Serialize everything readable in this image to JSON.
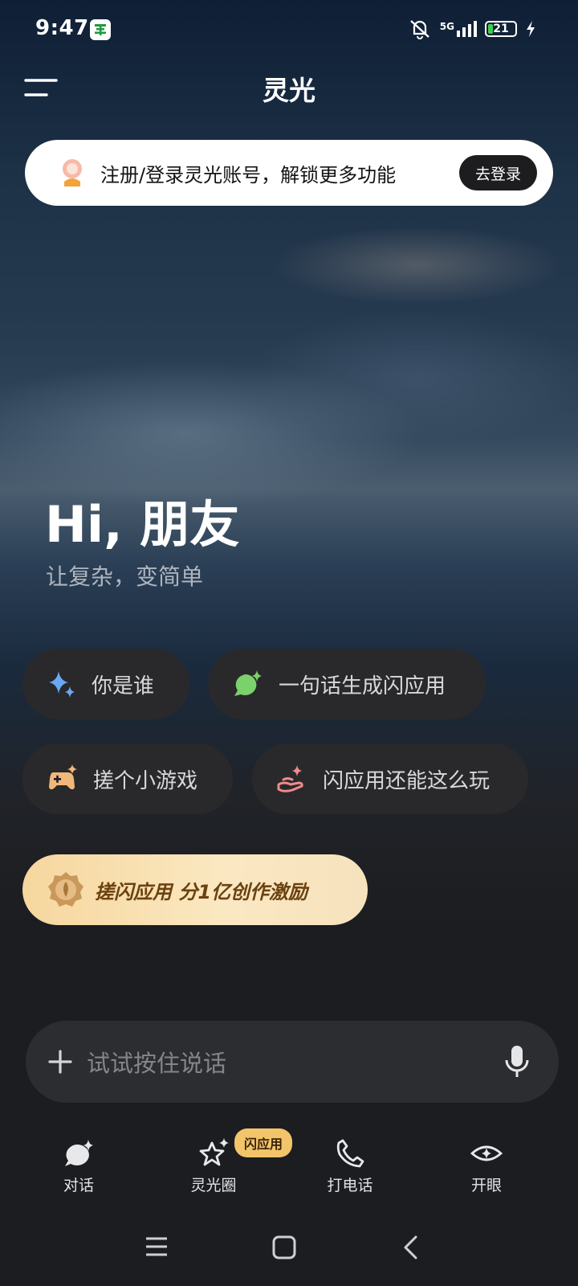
{
  "status_bar": {
    "time": "9:47",
    "network": "5G",
    "battery": "21"
  },
  "header": {
    "title": "灵光"
  },
  "login_banner": {
    "text": "注册/登录灵光账号，解锁更多功能",
    "button": "去登录"
  },
  "greeting": {
    "title": "Hi, 朋友",
    "subtitle": "让复杂，变简单"
  },
  "suggestions": [
    {
      "label": "你是谁",
      "icon": "sparkle-icon"
    },
    {
      "label": "一句话生成闪应用",
      "icon": "chat-bubble-sparkle-icon"
    },
    {
      "label": "搓个小游戏",
      "icon": "gamepad-icon"
    },
    {
      "label": "闪应用还能这么玩",
      "icon": "hand-sparkle-icon"
    }
  ],
  "promo": {
    "text": "搓闪应用 分1亿创作激励",
    "icon": "medal-icon"
  },
  "input": {
    "placeholder": "试试按住说话"
  },
  "tabs": [
    {
      "label": "对话",
      "icon": "chat-bubble-sparkle-icon",
      "active": true
    },
    {
      "label": "灵光圈",
      "icon": "star-sparkle-icon",
      "badge": "闪应用"
    },
    {
      "label": "打电话",
      "icon": "phone-icon"
    },
    {
      "label": "开眼",
      "icon": "eye-icon"
    }
  ],
  "colors": {
    "accent_blue": "#6aa8f5",
    "accent_green": "#7bd16a",
    "accent_orange": "#f1b77a",
    "accent_pink": "#f08a8a",
    "promo_gold": "#f6d79e",
    "badge_gold": "#f2c56b"
  }
}
